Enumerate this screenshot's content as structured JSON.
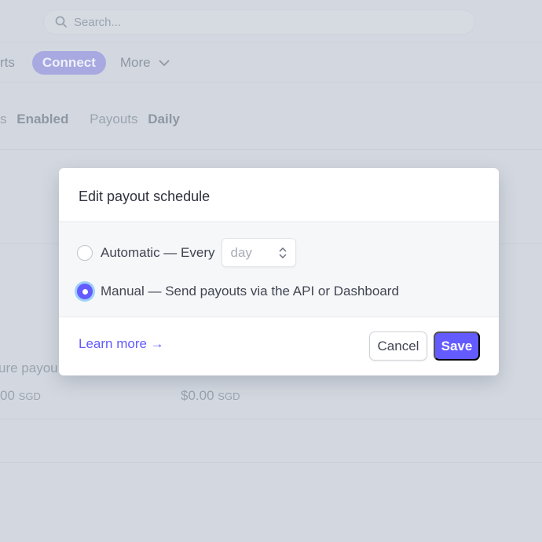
{
  "search": {
    "placeholder": "Search..."
  },
  "nav": {
    "partial_item": "rts",
    "connect": "Connect",
    "more": "More"
  },
  "stats": {
    "partial_label": "s",
    "partial_value": "Enabled",
    "payouts_label": "Payouts",
    "payouts_value": "Daily"
  },
  "background": {
    "partial_label": "ure payou",
    "amount1": "00",
    "amount2": "$0.00",
    "currency": "SGD"
  },
  "modal": {
    "title": "Edit payout schedule",
    "automatic_label": "Automatic — Every",
    "interval_value": "day",
    "manual_label": "Manual — Send payouts via the API or Dashboard",
    "selected": "manual",
    "learn_more": "Learn more →",
    "cancel": "Cancel",
    "save": "Save"
  },
  "colors": {
    "accent": "#635bff",
    "overlay": "#d3d8e0"
  }
}
